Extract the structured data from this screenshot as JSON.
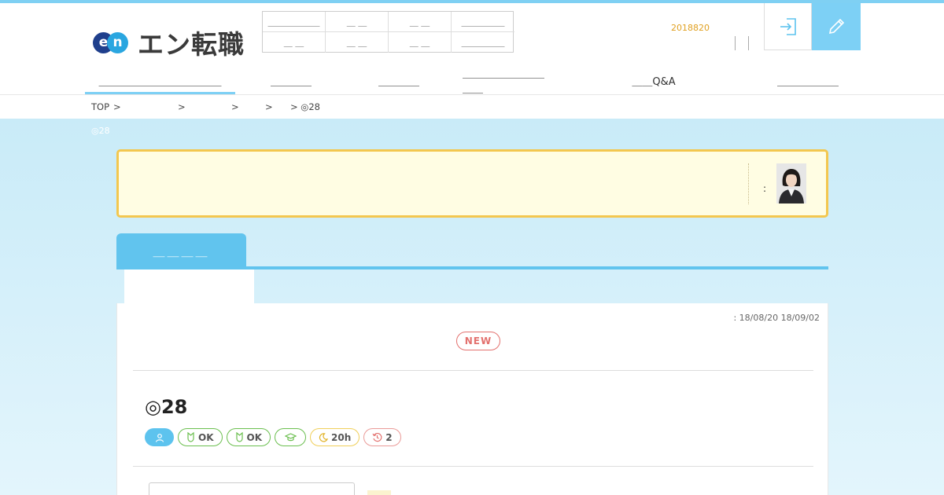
{
  "brand": {
    "logo_e": "e",
    "logo_n": "n",
    "name": "エン転職"
  },
  "categories": [
    {
      "label": "＿＿＿＿＿＿"
    },
    {
      "label": "＿ ＿"
    },
    {
      "label": "＿ ＿"
    },
    {
      "label": "＿＿＿＿＿"
    },
    {
      "label": "＿ ＿"
    },
    {
      "label": "＿ ＿"
    },
    {
      "label": "＿ ＿"
    },
    {
      "label": "＿＿＿＿＿"
    }
  ],
  "header": {
    "date_note": "2018820",
    "login_icon": "login-icon",
    "register_icon": "pencil-icon"
  },
  "nav": [
    {
      "label": "＿＿＿＿＿＿＿＿＿＿＿＿",
      "active": true
    },
    {
      "label": "＿＿＿＿"
    },
    {
      "label": "＿＿＿＿"
    },
    {
      "label": "＿＿＿＿＿＿＿＿＿＿"
    },
    {
      "label": "＿＿Q&A"
    },
    {
      "label": "＿＿＿＿＿＿"
    }
  ],
  "breadcrumb": {
    "top": "TOP",
    "sep1": ">",
    "sep2": ">",
    "sep3": ">",
    "sep4": ">",
    "current": "◎28"
  },
  "ghost_title": "◎28",
  "notice": {
    "colon": ":"
  },
  "tab": {
    "label": "＿＿＿＿"
  },
  "job": {
    "dates": ": 18/08/20 18/09/02",
    "new_badge": "NEW",
    "title": "◎28",
    "tags": [
      {
        "icon": "person-icon",
        "text": "",
        "style": "blue"
      },
      {
        "icon": "leaf-icon",
        "text": "OK",
        "style": "green"
      },
      {
        "icon": "leaf-icon",
        "text": "OK",
        "style": "green"
      },
      {
        "icon": "graduation-cap-icon",
        "text": "",
        "style": "green"
      },
      {
        "icon": "moon-icon",
        "text": "20h",
        "style": "yellow"
      },
      {
        "icon": "history-icon",
        "text": "2",
        "style": "red"
      }
    ]
  },
  "colors": {
    "accent": "#61c4ee",
    "notice_border": "#f3c74f",
    "new_badge": "#e3716e"
  }
}
